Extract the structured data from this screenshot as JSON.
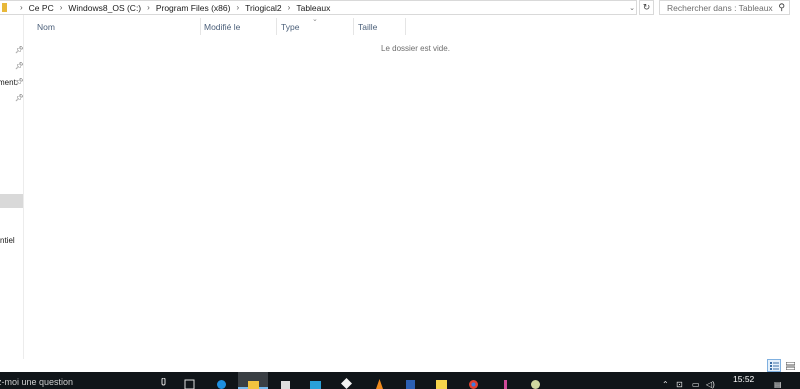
{
  "address_bar": {
    "crumbs": [
      "Ce PC",
      "Windows8_OS (C:)",
      "Program Files (x86)",
      "Triogical2",
      "Tableaux"
    ]
  },
  "search": {
    "placeholder": "Rechercher dans : Tableaux"
  },
  "nav_pane": {
    "partial_labels": [
      "ment:",
      "ntiel"
    ]
  },
  "columns": {
    "name": "Nom",
    "modified": "Modifié le",
    "type": "Type",
    "size": "Taille"
  },
  "empty_message": "Le dossier est vide.",
  "taskbar": {
    "search_text": "z-moi une question",
    "time": "15:52"
  },
  "colors": {
    "taskbar_bg": "#101519",
    "accent": "#76b9ed",
    "column_header_text": "#4c607a",
    "folder_icon": "#e8b83a"
  }
}
